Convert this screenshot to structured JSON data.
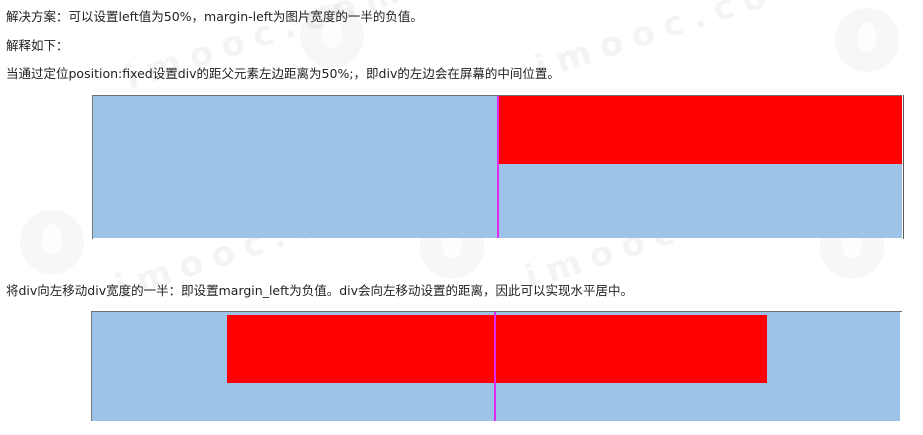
{
  "doc": {
    "line1": "解决方案：可以设置left值为50%，margin-left为图片宽度的一半的负值。",
    "line2": "解释如下：",
    "line3": "当通过定位position:fixed设置div的距父元素左边距离为50%;，即div的左边会在屏幕的中间位置。",
    "line4": "将div向左移动div宽度的一半：即设置margin_left为负值。div会向左移动设置的距离，因此可以实现水平居中。"
  },
  "watermark": {
    "text": "imooc.com"
  },
  "colors": {
    "container_bg": "#9dc3e8",
    "box": "#ff0000",
    "center_line": "#e02bf0"
  }
}
